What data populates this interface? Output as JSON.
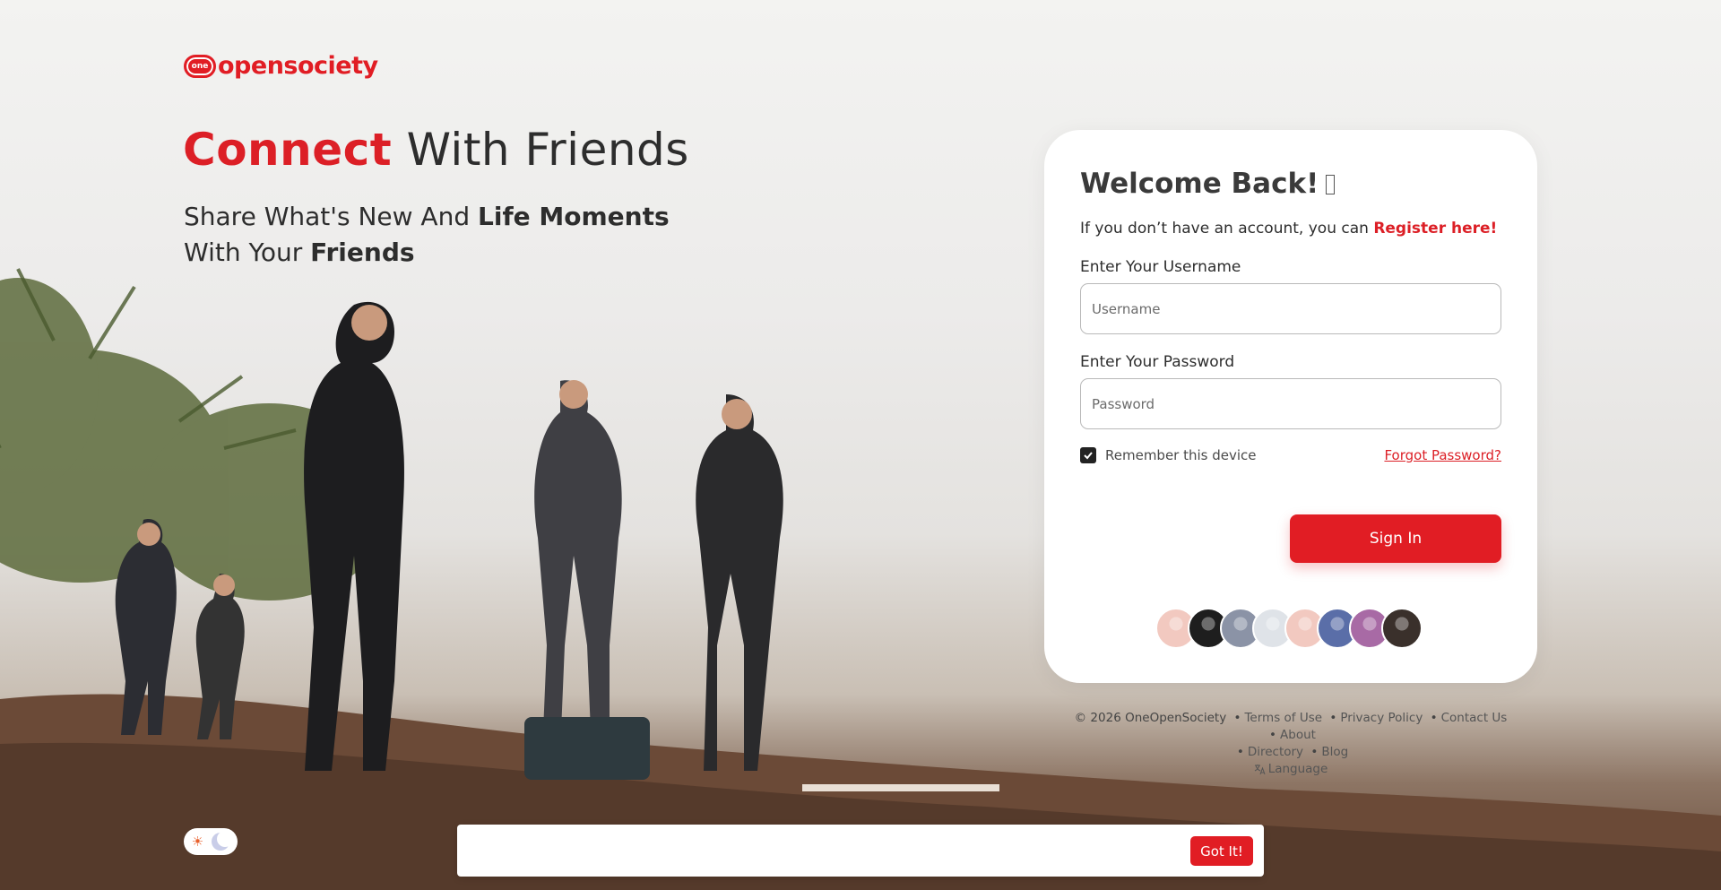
{
  "brand": {
    "badge": "one",
    "name": "opensociety",
    "accent_color": "#e11d24"
  },
  "hero": {
    "title_accent": "Connect",
    "title_rest": " With Friends",
    "subtitle_1": "Share What's New And ",
    "subtitle_bold_1": "Life Moments",
    "subtitle_2": " With Your ",
    "subtitle_bold_2": "Friends"
  },
  "login": {
    "title": "Welcome Back!",
    "register_prompt": "If you don’t have an account, you can ",
    "register_link": "Register here!",
    "username_label": "Enter Your Username",
    "username_placeholder": "Username",
    "username_value": "",
    "password_label": "Enter Your Password",
    "password_placeholder": "Password",
    "password_value": "",
    "remember_label": "Remember this device",
    "remember_checked": true,
    "forgot_label": "Forgot Password?",
    "signin_label": "Sign In"
  },
  "avatars": [
    {
      "name": "avatar-1",
      "color": "#f2c9c0"
    },
    {
      "name": "avatar-2",
      "color": "#1e1e1e"
    },
    {
      "name": "avatar-3",
      "color": "#8b93a6"
    },
    {
      "name": "avatar-4",
      "color": "#dfe3e8"
    },
    {
      "name": "avatar-5",
      "color": "#f2c9c0"
    },
    {
      "name": "avatar-6",
      "color": "#5a6ea8"
    },
    {
      "name": "avatar-7",
      "color": "#a86aa5"
    },
    {
      "name": "avatar-8",
      "color": "#3a302b"
    }
  ],
  "footer": {
    "copyright": "© 2026 OneOpenSociety",
    "links": [
      "Terms of Use",
      "Privacy Policy",
      "Contact Us",
      "About",
      "Directory",
      "Blog"
    ],
    "language": "Language"
  },
  "cookie": {
    "text": "",
    "button": "Got It!"
  }
}
